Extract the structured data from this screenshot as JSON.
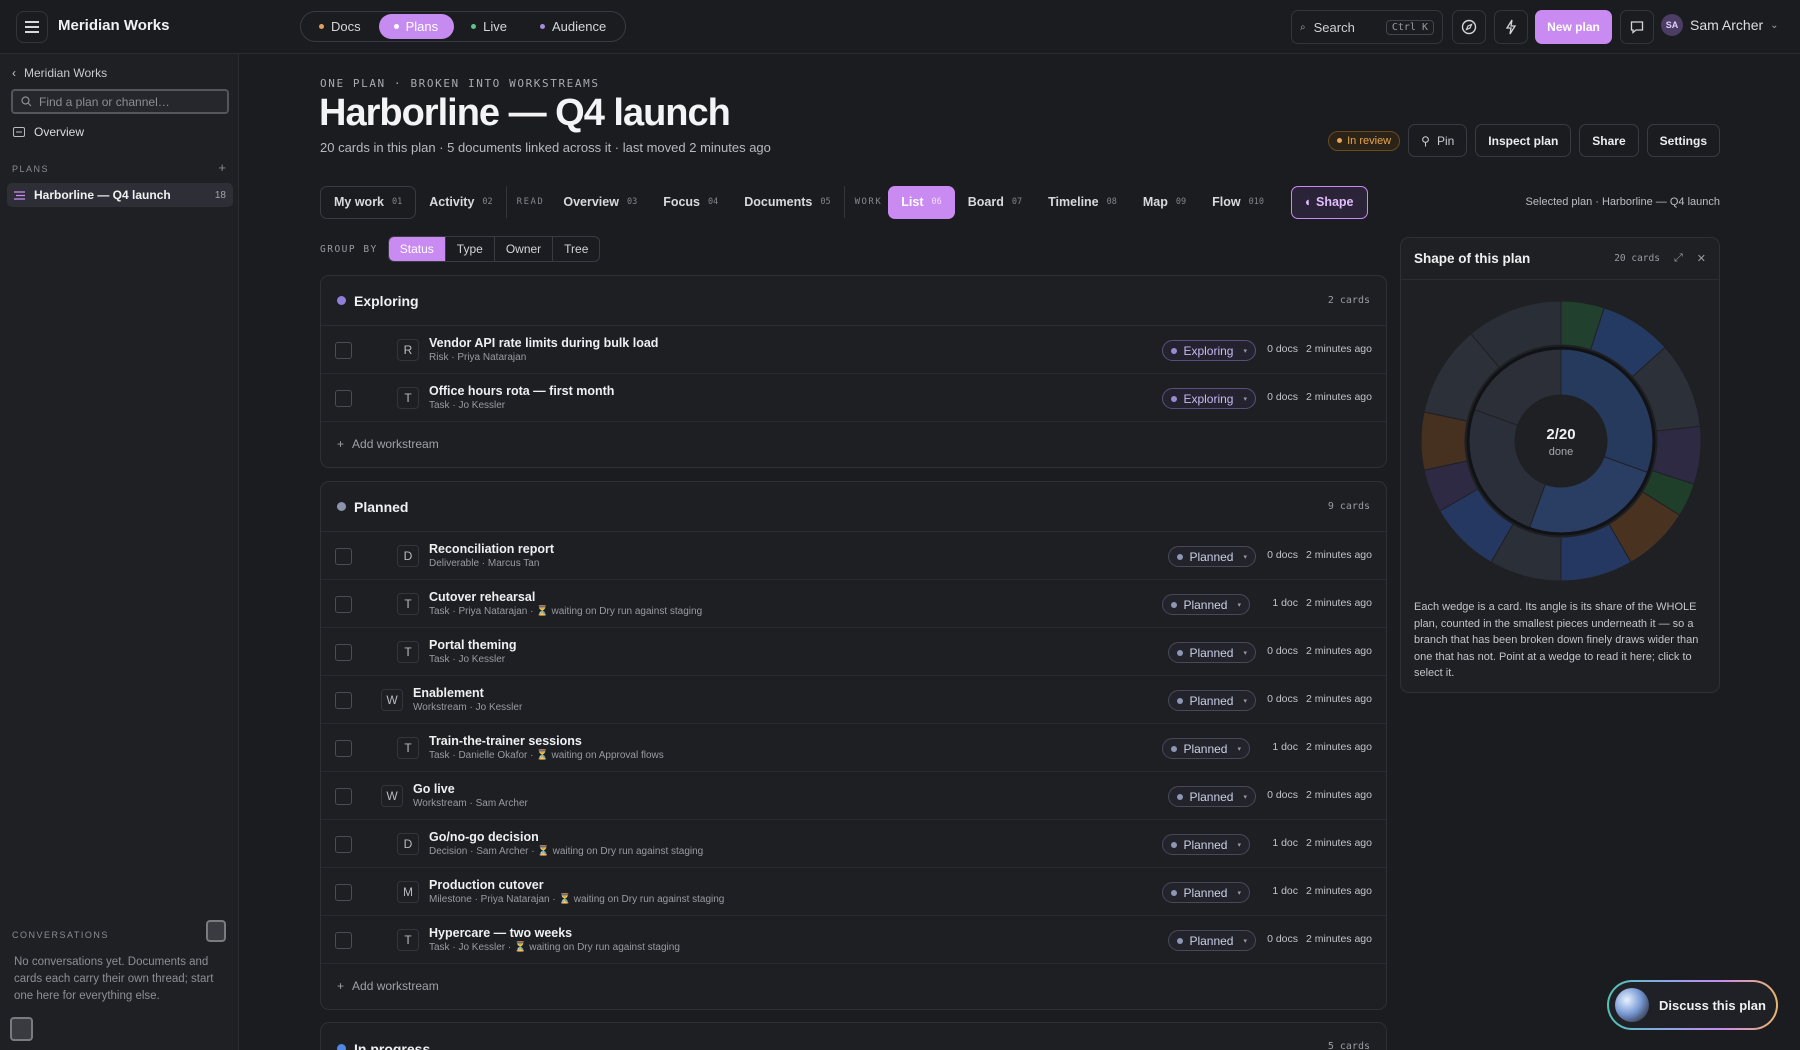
{
  "app": {
    "name": "Meridian Works"
  },
  "nav": {
    "segments": [
      {
        "label": "Docs",
        "dot": "#e0a060"
      },
      {
        "label": "Plans",
        "dot": "#ffffff"
      },
      {
        "label": "Live",
        "dot": "#5ec28a"
      },
      {
        "label": "Audience",
        "dot": "#a88ae0"
      }
    ],
    "active": "Plans"
  },
  "topbar": {
    "search_label": "Search",
    "search_shortcut": "Ctrl K",
    "new_plan": "New plan",
    "user_name": "Sam Archer",
    "user_initials": "SA"
  },
  "sidebar": {
    "back_label": "Meridian Works",
    "find_placeholder": "Find a plan or channel…",
    "overview": "Overview",
    "plans_label": "PLANS",
    "plan_name": "Harborline — Q4 launch",
    "plan_count": "18",
    "conversations_label": "CONVERSATIONS",
    "conversations_empty": "No conversations yet. Documents and cards each carry their own thread; start one here for everything else."
  },
  "header": {
    "eyebrow": "ONE PLAN · BROKEN INTO WORKSTREAMS",
    "title": "Harborline — Q4 launch",
    "subtitle": "20 cards in this plan · 5 documents linked across it · last moved 2 minutes ago",
    "status_badge": "In review",
    "pin": "Pin",
    "inspect": "Inspect plan",
    "share": "Share",
    "settings": "Settings"
  },
  "tabs": {
    "my_work": {
      "label": "My work",
      "n": "01"
    },
    "activity": {
      "label": "Activity",
      "n": "02"
    },
    "read_label": "READ",
    "overview": {
      "label": "Overview",
      "n": "03"
    },
    "focus": {
      "label": "Focus",
      "n": "04"
    },
    "documents": {
      "label": "Documents",
      "n": "05"
    },
    "work_label": "WORK",
    "list": {
      "label": "List",
      "n": "06"
    },
    "board": {
      "label": "Board",
      "n": "07"
    },
    "timeline": {
      "label": "Timeline",
      "n": "08"
    },
    "map": {
      "label": "Map",
      "n": "09"
    },
    "flow": {
      "label": "Flow",
      "n": "010"
    },
    "shape": "◐ Shape",
    "selected_plan": "Selected plan · Harborline — Q4 launch"
  },
  "group_by": {
    "label": "GROUP BY",
    "options": [
      "Status",
      "Type",
      "Owner",
      "Tree"
    ],
    "active": "Status"
  },
  "groups": {
    "exploring": {
      "name": "Exploring",
      "count": "2 cards",
      "color": "#8f7fd6",
      "rows": [
        {
          "glyph": "R",
          "title": "Vendor API rate limits during bulk load",
          "meta": "Risk · Priya Natarajan",
          "wait": "",
          "status": "Exploring",
          "docs": "0 docs",
          "ago": "2 minutes ago",
          "indent": 1
        },
        {
          "glyph": "T",
          "title": "Office hours rota — first month",
          "meta": "Task · Jo Kessler",
          "wait": "",
          "status": "Exploring",
          "docs": "0 docs",
          "ago": "2 minutes ago",
          "indent": 1
        }
      ],
      "add": "Add workstream"
    },
    "planned": {
      "name": "Planned",
      "count": "9 cards",
      "color": "#8c93ad",
      "rows": [
        {
          "glyph": "D",
          "title": "Reconciliation report",
          "meta": "Deliverable · Marcus Tan",
          "wait": "",
          "status": "Planned",
          "docs": "0 docs",
          "ago": "2 minutes ago",
          "indent": 1
        },
        {
          "glyph": "T",
          "title": "Cutover rehearsal",
          "meta": "Task · Priya Natarajan · ",
          "wait": "⏳ waiting on Dry run against staging",
          "status": "Planned",
          "docs": "1 doc",
          "ago": "2 minutes ago",
          "indent": 1
        },
        {
          "glyph": "T",
          "title": "Portal theming",
          "meta": "Task · Jo Kessler",
          "wait": "",
          "status": "Planned",
          "docs": "0 docs",
          "ago": "2 minutes ago",
          "indent": 1
        },
        {
          "glyph": "W",
          "title": "Enablement",
          "meta": "Workstream · Jo Kessler",
          "wait": "",
          "status": "Planned",
          "docs": "0 docs",
          "ago": "2 minutes ago",
          "indent": 0
        },
        {
          "glyph": "T",
          "title": "Train-the-trainer sessions",
          "meta": "Task · Danielle Okafor · ",
          "wait": "⏳ waiting on Approval flows",
          "status": "Planned",
          "docs": "1 doc",
          "ago": "2 minutes ago",
          "indent": 1
        },
        {
          "glyph": "W",
          "title": "Go live",
          "meta": "Workstream · Sam Archer",
          "wait": "",
          "status": "Planned",
          "docs": "0 docs",
          "ago": "2 minutes ago",
          "indent": 0
        },
        {
          "glyph": "D",
          "title": "Go/no-go decision",
          "meta": "Decision · Sam Archer · ",
          "wait": "⏳ waiting on Dry run against staging",
          "status": "Planned",
          "docs": "1 doc",
          "ago": "2 minutes ago",
          "indent": 1
        },
        {
          "glyph": "M",
          "title": "Production cutover",
          "meta": "Milestone · Priya Natarajan · ",
          "wait": "⏳ waiting on Dry run against staging",
          "status": "Planned",
          "docs": "1 doc",
          "ago": "2 minutes ago",
          "indent": 1
        },
        {
          "glyph": "T",
          "title": "Hypercare — two weeks",
          "meta": "Task · Jo Kessler · ",
          "wait": "⏳ waiting on Dry run against staging",
          "status": "Planned",
          "docs": "0 docs",
          "ago": "2 minutes ago",
          "indent": 1
        }
      ],
      "add": "Add workstream"
    },
    "in_progress": {
      "name": "In progress",
      "count": "5 cards",
      "color": "#4f86e8"
    }
  },
  "shape_panel": {
    "title": "Shape of this plan",
    "count": "20 cards",
    "center_value": "2/20",
    "center_label": "done",
    "description": "Each wedge is a card. Its angle is its share of the WHOLE plan, counted in the smallest pieces underneath it — so a branch that has been broken down finely draws wider than one that has not. Point at a wedge to read it here; click to select it."
  },
  "discuss": "Discuss this plan"
}
